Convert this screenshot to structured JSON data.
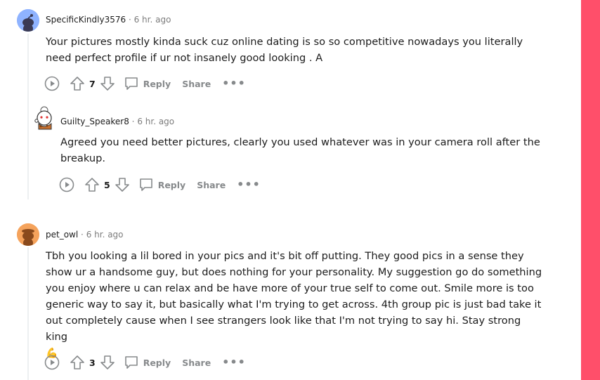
{
  "colors": {
    "accent_side": "#ff4f6a",
    "meta_gray": "#7c7c7c",
    "action_gray": "#878a8c",
    "text": "#1c1c1c"
  },
  "comments": [
    {
      "username": "SpecificKindly3576",
      "separator": "·",
      "time": "6 hr. ago",
      "text": "Your pictures mostly kinda suck cuz online dating is so so competitive nowadays you literally need perfect profile if ur not insanely good looking . A",
      "votes": "7",
      "reply_label": "Reply",
      "share_label": "Share",
      "more_label": "•••",
      "avatar_icon": "snoo-avatar-blue"
    },
    {
      "username": "Guilty_Speaker8",
      "separator": "·",
      "time": "6 hr. ago",
      "text": "Agreed you need better pictures, clearly you used whatever was in your camera roll after the breakup.",
      "votes": "5",
      "reply_label": "Reply",
      "share_label": "Share",
      "more_label": "•••",
      "avatar_icon": "snoo-avatar-custom"
    },
    {
      "username": "pet_owl",
      "separator": "·",
      "time": "6 hr. ago",
      "text": "Tbh you looking a lil bored in your pics and it's bit off putting. They good pics in a sense they show ur a handsome guy, but does nothing for your personality. My suggestion go do something you enjoy where u can relax and be have more of your true self to come out. Smile more is too generic way to say it, but basically what I'm trying to get across. 4th group pic is just bad take it out completely cause when I see strangers look like that I'm not trying to say hi. Stay strong king",
      "emoji": "💪",
      "votes": "3",
      "reply_label": "Reply",
      "share_label": "Share",
      "more_label": "•••",
      "avatar_icon": "snoo-avatar-orange"
    }
  ]
}
